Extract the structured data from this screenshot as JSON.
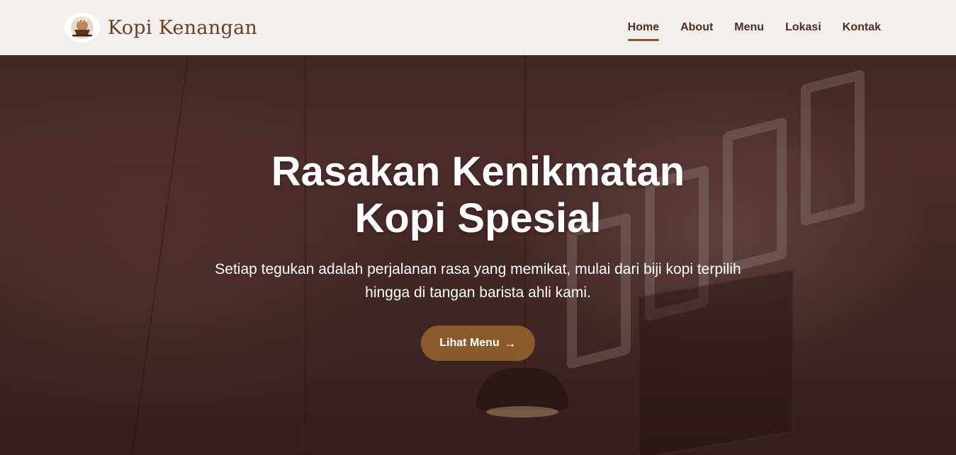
{
  "brand": {
    "name": "Kopi Kenangan",
    "logo_icon": "coffee-cup-icon"
  },
  "nav": {
    "items": [
      {
        "label": "Home",
        "active": true
      },
      {
        "label": "About",
        "active": false
      },
      {
        "label": "Menu",
        "active": false
      },
      {
        "label": "Lokasi",
        "active": false
      },
      {
        "label": "Kontak",
        "active": false
      }
    ]
  },
  "hero": {
    "title": "Rasakan Kenikmatan Kopi Spesial",
    "subtitle": "Setiap tegukan adalah perjalanan rasa yang memikat, mulai dari biji kopi terpilih hingga di tangan barista ahli kami.",
    "cta_label": "Lihat Menu",
    "cta_icon": "arrow-right-icon",
    "cta_arrow": "→"
  },
  "colors": {
    "accent": "#8b5a2b",
    "brand_text": "#6b3f24",
    "nav_text": "#4b2e24",
    "navbar_bg": "#f1eeec",
    "hero_text": "#ffffff"
  }
}
